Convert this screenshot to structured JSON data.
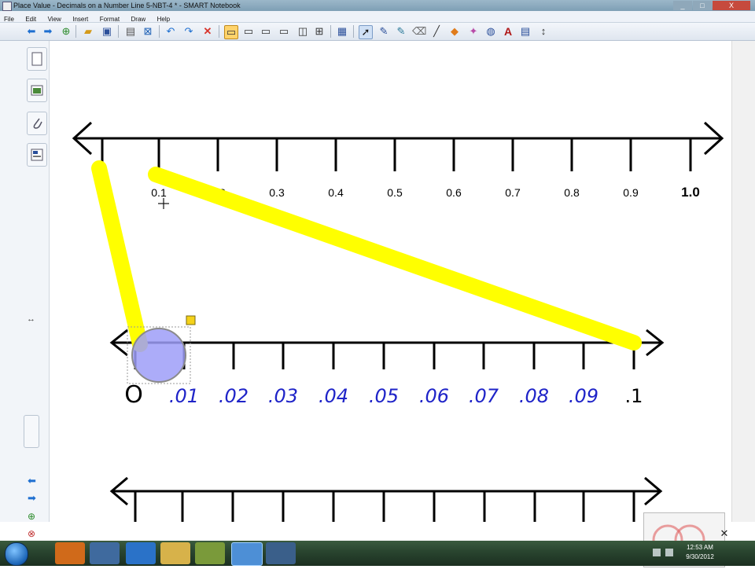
{
  "window": {
    "title": "Place Value - Decimals on a Number Line  5-NBT-4 * - SMART Notebook",
    "controls": [
      "_",
      "□",
      "X"
    ]
  },
  "menu": [
    "File",
    "Edit",
    "View",
    "Insert",
    "Format",
    "Draw",
    "Help"
  ],
  "toolbar": {
    "icons": [
      "back-icon",
      "forward-icon",
      "add-page-icon",
      "open-icon",
      "save-icon",
      "paste-icon",
      "delete-page-icon",
      "undo-icon",
      "redo-icon",
      "delete-icon",
      "screen-shade-icon",
      "display-icon",
      "document-camera-icon",
      "capture-icon",
      "full-screen-icon",
      "table-icon",
      "select-icon",
      "pen-icon",
      "creative-pen-icon",
      "eraser-icon",
      "line-icon",
      "shapes-icon",
      "magic-pen-icon",
      "fill-icon",
      "text-icon",
      "properties-icon",
      "move-toolbar-icon"
    ],
    "text_icon_glyph": "A"
  },
  "number_line_top": {
    "labels": [
      "0",
      "0.1",
      "0.2",
      "0.3",
      "0.4",
      "0.5",
      "0.6",
      "0.7",
      "0.8",
      "0.9",
      "1.0"
    ]
  },
  "number_line_middle": {
    "labels": [
      "O",
      ".01",
      ".02",
      ".03",
      ".04",
      ".05",
      ".06",
      ".07",
      ".08",
      ".09",
      ".1"
    ],
    "ink_color": "#1f24c8"
  },
  "highlight_color": "#ffff00",
  "selection_circle_color": "#9d9ef8",
  "taskbar": {
    "time": "12:53 AM",
    "date": "9/30/2012"
  }
}
